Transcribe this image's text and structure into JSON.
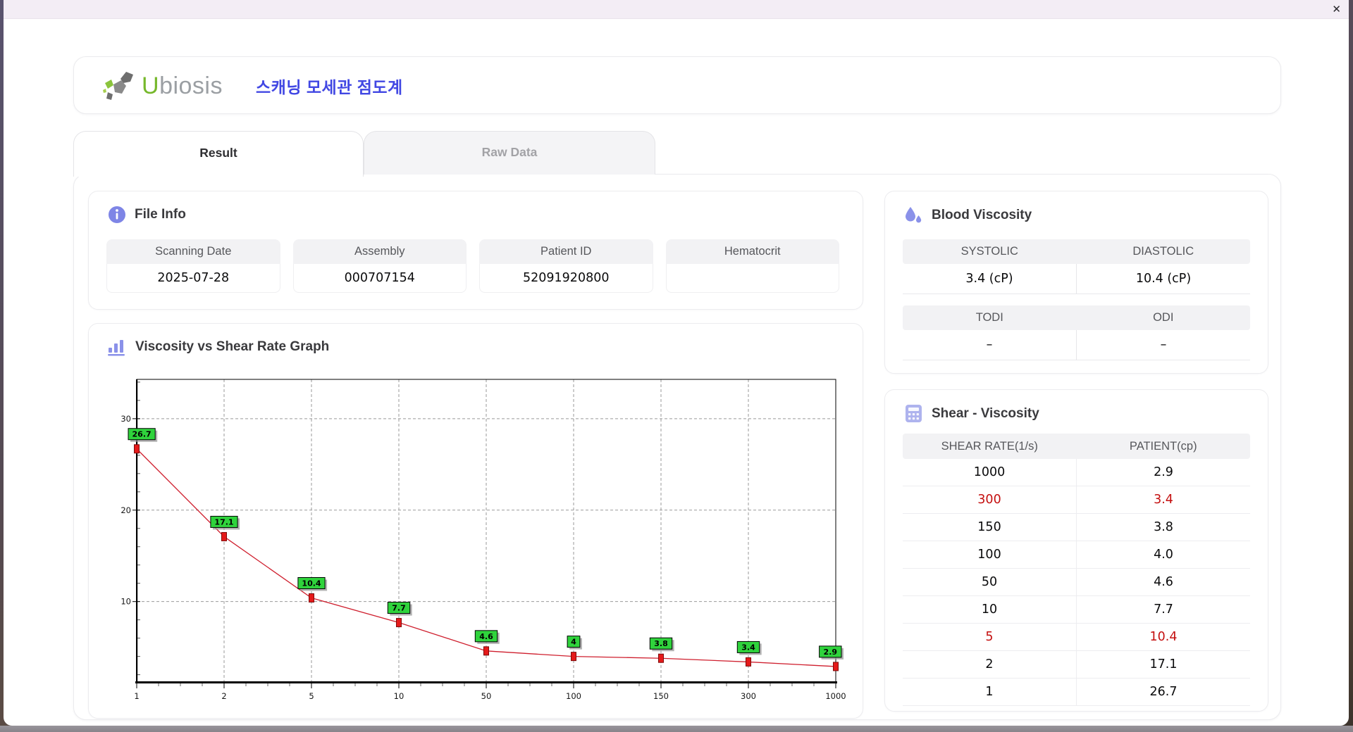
{
  "window": {
    "close_glyph": "✕"
  },
  "header": {
    "brand_u": "U",
    "brand_rest": "biosis",
    "title_ko": "스캐닝 모세관 점도계",
    "brand_green": "#76b82b",
    "brand_gray": "#9b9fa3",
    "title_color": "#4147e3"
  },
  "tabs": [
    {
      "label": "Result",
      "active": true
    },
    {
      "label": "Raw Data",
      "active": false
    }
  ],
  "file_info": {
    "title": "File Info",
    "fields": [
      {
        "label": "Scanning Date",
        "value": "2025-07-28"
      },
      {
        "label": "Assembly",
        "value": "000707154"
      },
      {
        "label": "Patient ID",
        "value": "52091920800"
      },
      {
        "label": "Hematocrit",
        "value": ""
      }
    ]
  },
  "blood_viscosity": {
    "title": "Blood Viscosity",
    "groups": [
      {
        "cells": [
          {
            "label": "SYSTOLIC",
            "value": "3.4 (cP)"
          },
          {
            "label": "DIASTOLIC",
            "value": "10.4 (cP)"
          }
        ]
      },
      {
        "cells": [
          {
            "label": "TODI",
            "value": "–"
          },
          {
            "label": "ODI",
            "value": "–"
          }
        ]
      }
    ]
  },
  "shear_viscosity": {
    "title": "Shear - Viscosity",
    "columns": [
      "SHEAR RATE(1/s)",
      "PATIENT(cp)"
    ],
    "highlight_color": "#c40f0f",
    "rows": [
      {
        "shear_rate": "1000",
        "patient": "2.9",
        "highlight": false
      },
      {
        "shear_rate": "300",
        "patient": "3.4",
        "highlight": true
      },
      {
        "shear_rate": "150",
        "patient": "3.8",
        "highlight": false
      },
      {
        "shear_rate": "100",
        "patient": "4.0",
        "highlight": false
      },
      {
        "shear_rate": "50",
        "patient": "4.6",
        "highlight": false
      },
      {
        "shear_rate": "10",
        "patient": "7.7",
        "highlight": false
      },
      {
        "shear_rate": "5",
        "patient": "10.4",
        "highlight": true
      },
      {
        "shear_rate": "2",
        "patient": "17.1",
        "highlight": false
      },
      {
        "shear_rate": "1",
        "patient": "26.7",
        "highlight": false
      }
    ]
  },
  "graph": {
    "title": "Viscosity vs Shear Rate Graph"
  },
  "chart_data": {
    "type": "line",
    "title": "Viscosity vs Shear Rate Graph",
    "xlabel": "",
    "ylabel": "",
    "x_scale": "categorical",
    "categories": [
      "1",
      "2",
      "5",
      "10",
      "50",
      "100",
      "150",
      "300",
      "1000"
    ],
    "values": [
      26.7,
      17.1,
      10.4,
      7.7,
      4.6,
      4.0,
      3.8,
      3.4,
      2.9
    ],
    "point_labels": [
      "26.7",
      "17.1",
      "10.4",
      "7.7",
      "4.6",
      "4",
      "3.8",
      "3.4",
      "2.9"
    ],
    "ylim": [
      1.2,
      34.3
    ],
    "yticks": [
      10,
      20,
      30
    ],
    "grid": "dashed",
    "legend": "none",
    "line_color": "#cf1f2e",
    "marker_color": "#e51a1a",
    "marker_stroke": "#7d0b0b",
    "label_bg": "#2fd33c",
    "grid_color": "#9a9a9a"
  }
}
